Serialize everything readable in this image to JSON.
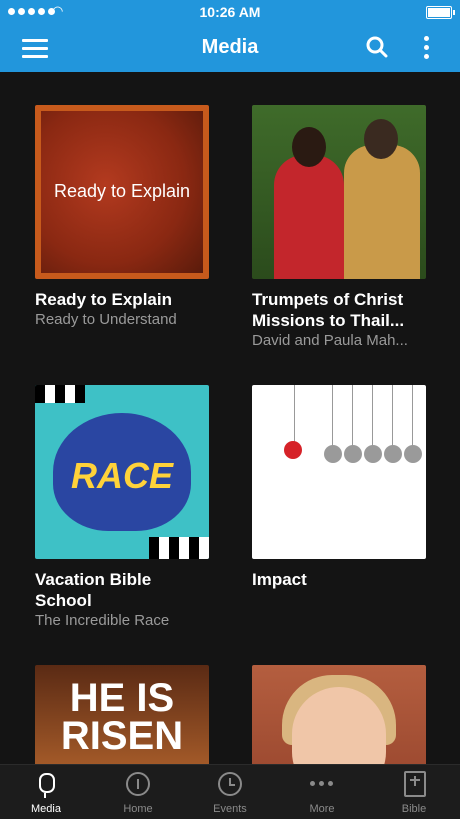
{
  "status": {
    "time": "10:26 AM"
  },
  "appbar": {
    "title": "Media"
  },
  "cards": [
    {
      "title": "Ready to Explain",
      "subtitle": "Ready to Understand",
      "thumb_text": "Ready to Explain"
    },
    {
      "title": "Trumpets of Christ Missions to Thail...",
      "subtitle": "David and Paula Mah..."
    },
    {
      "title": "Vacation Bible School",
      "subtitle": "The Incredible Race",
      "thumb_text": "RACE"
    },
    {
      "title": "Impact",
      "subtitle": ""
    },
    {
      "title": "",
      "subtitle": "",
      "thumb_text": "HE IS RISEN"
    },
    {
      "title": "",
      "subtitle": ""
    }
  ],
  "tabs": [
    {
      "label": "Media",
      "icon": "microphone-icon",
      "active": true
    },
    {
      "label": "Home",
      "icon": "info-icon",
      "active": false
    },
    {
      "label": "Events",
      "icon": "clock-icon",
      "active": false
    },
    {
      "label": "More",
      "icon": "more-horizontal-icon",
      "active": false
    },
    {
      "label": "Bible",
      "icon": "bible-icon",
      "active": false
    }
  ],
  "colors": {
    "accent": "#2296dc",
    "background": "#141414",
    "tabbar": "#1c1c1c"
  }
}
